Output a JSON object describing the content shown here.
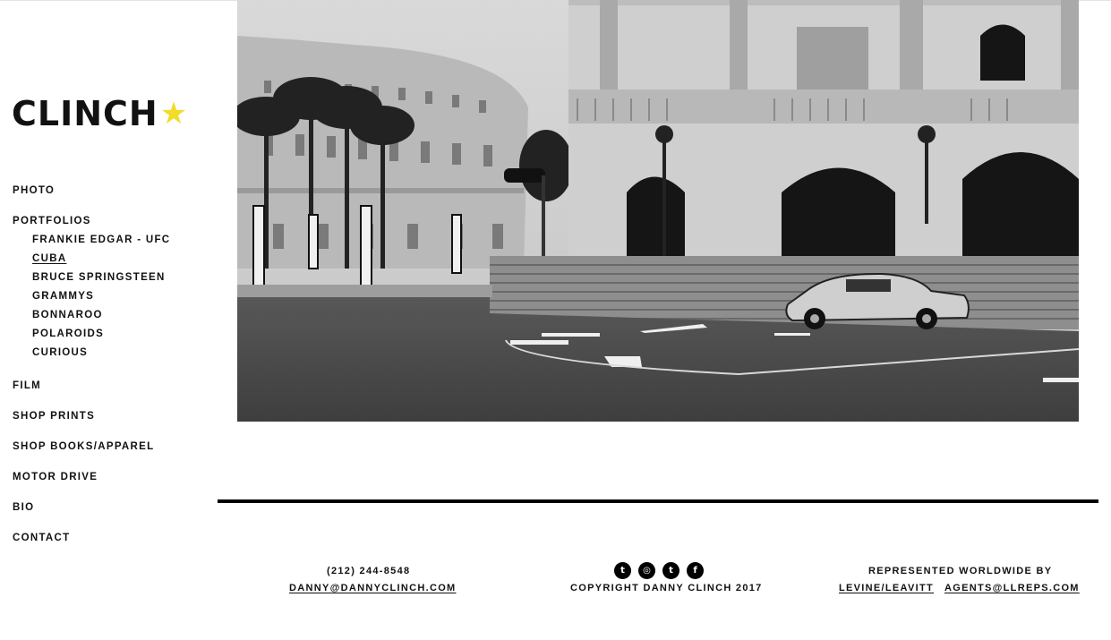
{
  "brand": {
    "name": "CLINCH",
    "star_icon": "star-icon",
    "star_color": "#f2dc2a"
  },
  "nav": {
    "photo": "PHOTO",
    "portfolios": "PORTFOLIOS",
    "portfolio_items": [
      "FRANKIE EDGAR - UFC",
      "CUBA",
      "BRUCE SPRINGSTEEN",
      "GRAMMYS",
      "BONNAROO",
      "POLAROIDS",
      "CURIOUS"
    ],
    "active_portfolio": "CUBA",
    "film": "FILM",
    "shop_prints": "SHOP PRINTS",
    "shop_books": "SHOP BOOKS/APPAREL",
    "motor_drive": "MOTOR DRIVE",
    "bio": "BIO",
    "contact": "CONTACT"
  },
  "hero": {
    "photo_style": "black and white street scene"
  },
  "footer": {
    "phone": "(212) 244-8548",
    "email": "DANNY@DANNYCLINCH.COM",
    "copyright": "COPYRIGHT DANNY CLINCH 2017",
    "represented_by": "REPRESENTED WORLDWIDE BY",
    "agency": "LEVINE/LEAVITT",
    "agency_email": "AGENTS@LLREPS.COM",
    "social_icons": [
      "twitter-icon",
      "instagram-icon",
      "tumblr-icon",
      "facebook-icon"
    ],
    "social_glyphs": {
      "twitter": "t",
      "instagram": "◎",
      "tumblr": "t",
      "facebook": "f"
    }
  }
}
